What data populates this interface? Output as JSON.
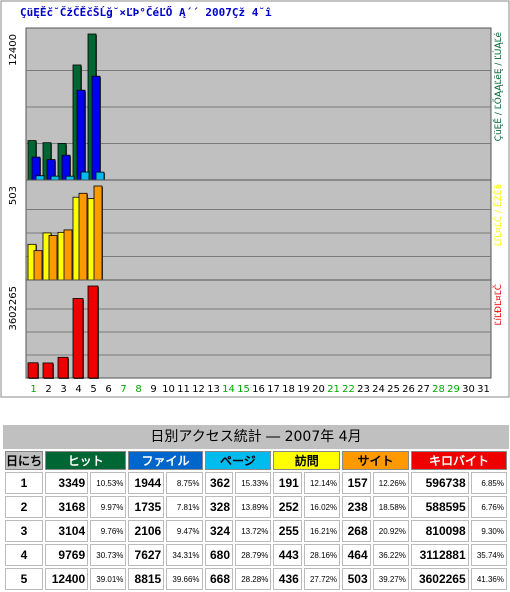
{
  "chart_title": "ÇüĘĚč˘ČžČĚčŠĹǧ˘×ĽÞ°ČéĽŐ Ą´´ 2007Çž 4˘î",
  "colors": {
    "hit": "#006633",
    "file": "#0000ee",
    "page": "#00bbee",
    "visit": "#ffff00",
    "site": "#ff9900",
    "kb": "#ee0000",
    "plot_bg": "#c0c0c0"
  },
  "chart_data": {
    "type": "bar",
    "title": "ÇüĘĚč˘ČžČĚčŠĹǧ˘×ĽÞ°ČéĽŐ Ą´´ 2007Çž 4˘î",
    "categories": [
      "1",
      "2",
      "3",
      "4",
      "5",
      "6",
      "7",
      "8",
      "9",
      "10",
      "11",
      "12",
      "13",
      "14",
      "15",
      "16",
      "17",
      "18",
      "19",
      "20",
      "21",
      "22",
      "23",
      "24",
      "25",
      "26",
      "27",
      "28",
      "29",
      "30",
      "31"
    ],
    "weekend_days": [
      "1",
      "7",
      "8",
      "14",
      "15",
      "21",
      "22",
      "28",
      "29"
    ],
    "panels": [
      {
        "max_label": "12400",
        "ymax": 12400,
        "series": [
          {
            "name": "ÇüĘĚ",
            "values": [
              3349,
              3168,
              3104,
              9769,
              12400
            ]
          },
          {
            "name": "ĽŐĄĄĽëĘ",
            "values": [
              1944,
              1735,
              2106,
              7627,
              8815
            ]
          },
          {
            "name": "ĽÚĄĽé",
            "values": [
              362,
              328,
              324,
              680,
              668
            ]
          }
        ],
        "right_label": "ÇüĘĚ / ĽŐĄĄĽëĘ / ĽÚĄĽé"
      },
      {
        "max_label": "503",
        "ymax": 503,
        "series": [
          {
            "name": "ËŹĚä",
            "values": [
              191,
              252,
              255,
              443,
              436
            ]
          },
          {
            "name": "ĽľĽ¤ĽČ",
            "values": [
              157,
              238,
              268,
              464,
              503
            ]
          }
        ],
        "right_label": "ĽľĽ¤ĽČ / ËŹĚä"
      },
      {
        "max_label": "3602265",
        "ymax": 3602265,
        "series": [
          {
            "name": "ĽíĽĐĽ¤ĽČ",
            "values": [
              596738,
              588595,
              810098,
              3112881,
              3602265
            ]
          }
        ],
        "right_label": "ĽíĽĐĽ¤ĽČ"
      }
    ]
  },
  "table": {
    "title": "日別アクセス統計 ― 2007年 4月",
    "headers": {
      "day": "日にち",
      "hit": "ヒット",
      "file": "ファイル",
      "page": "ページ",
      "visit": "訪問",
      "site": "サイト",
      "kb": "キロバイト"
    },
    "rows": [
      {
        "day": "1",
        "hit": "3349",
        "hit_pct": "10.53%",
        "file": "1944",
        "file_pct": "8.75%",
        "page": "362",
        "page_pct": "15.33%",
        "visit": "191",
        "visit_pct": "12.14%",
        "site": "157",
        "site_pct": "12.26%",
        "kb": "596738",
        "kb_pct": "6.85%"
      },
      {
        "day": "2",
        "hit": "3168",
        "hit_pct": "9.97%",
        "file": "1735",
        "file_pct": "7.81%",
        "page": "328",
        "page_pct": "13.89%",
        "visit": "252",
        "visit_pct": "16.02%",
        "site": "238",
        "site_pct": "18.58%",
        "kb": "588595",
        "kb_pct": "6.76%"
      },
      {
        "day": "3",
        "hit": "3104",
        "hit_pct": "9.76%",
        "file": "2106",
        "file_pct": "9.47%",
        "page": "324",
        "page_pct": "13.72%",
        "visit": "255",
        "visit_pct": "16.21%",
        "site": "268",
        "site_pct": "20.92%",
        "kb": "810098",
        "kb_pct": "9.30%"
      },
      {
        "day": "4",
        "hit": "9769",
        "hit_pct": "30.73%",
        "file": "7627",
        "file_pct": "34.31%",
        "page": "680",
        "page_pct": "28.79%",
        "visit": "443",
        "visit_pct": "28.16%",
        "site": "464",
        "site_pct": "36.22%",
        "kb": "3112881",
        "kb_pct": "35.74%"
      },
      {
        "day": "5",
        "hit": "12400",
        "hit_pct": "39.01%",
        "file": "8815",
        "file_pct": "39.66%",
        "page": "668",
        "page_pct": "28.28%",
        "visit": "436",
        "visit_pct": "27.72%",
        "site": "503",
        "site_pct": "39.27%",
        "kb": "3602265",
        "kb_pct": "41.36%"
      }
    ]
  }
}
